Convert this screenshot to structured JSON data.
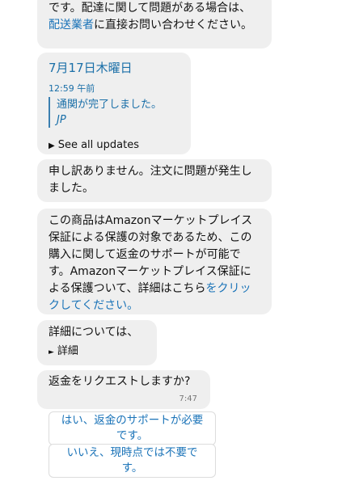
{
  "messages": {
    "m1": {
      "text_a": "です。配達に関して問題がある場合は、",
      "link": "配送業者",
      "text_b": "に直接お問い合わせください。"
    },
    "tracking": {
      "date": "7月17日木曜日",
      "time": "12:59 午前",
      "status": "通関が完了しました。",
      "carrier": "JP",
      "see_all": "See all updates"
    },
    "m3": {
      "text": "申し訳ありません。注文に問題が発生しました。"
    },
    "m4": {
      "text": "この商品はAmazonマーケットプレイス保証による保護の対象であるため、この購入に関して返金のサポートが可能です。Amazonマーケットプレイス保証による保護ついて、詳細はこちら",
      "link": "をクリックしてください。"
    },
    "m5": {
      "text": "詳細については、",
      "detail": "詳細"
    },
    "m6": {
      "text": "返金をリクエストしますか?",
      "time": "7:47"
    }
  },
  "quick_replies": {
    "yes": "はい、返金のサポートが必要です。",
    "no": "いいえ、現時点では不要です。"
  },
  "colors": {
    "link": "#1a73b8",
    "bubble": "#efefef"
  }
}
